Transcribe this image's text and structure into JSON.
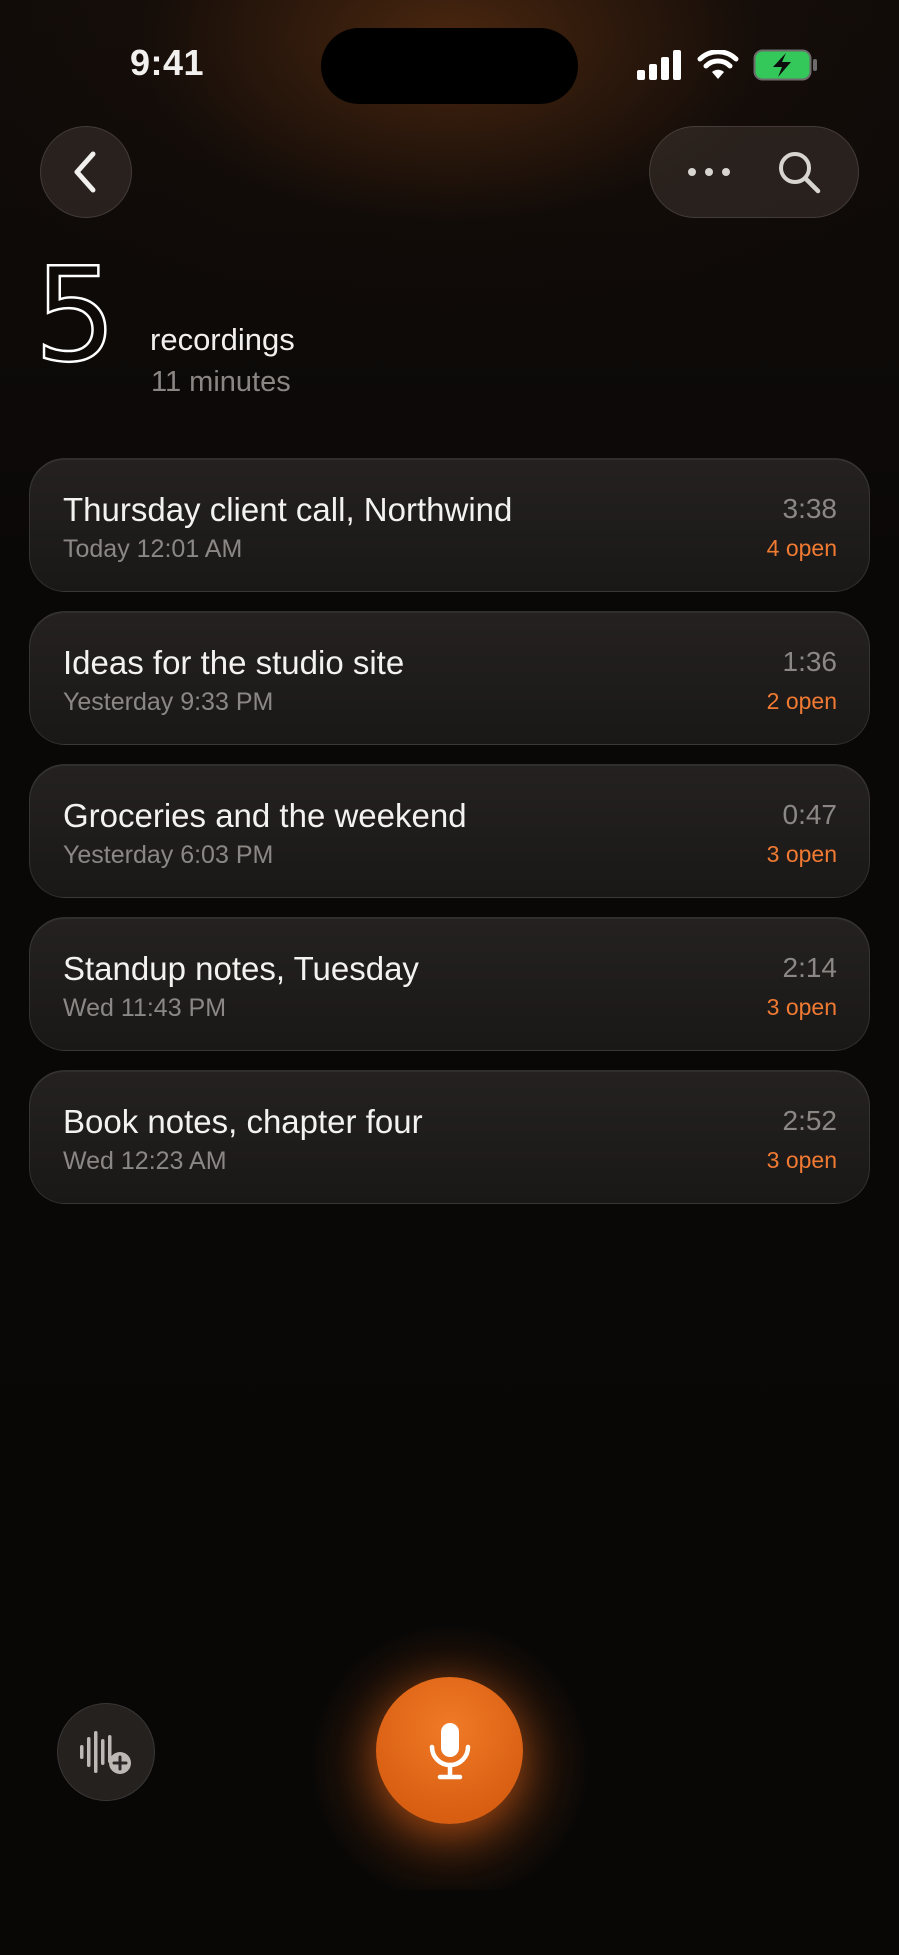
{
  "status_bar": {
    "time": "9:41",
    "icons": [
      "signal-icon",
      "wifi-icon",
      "battery-charging-icon"
    ],
    "battery_color": "#34c759"
  },
  "nav": {
    "back_icon": "chevron-left-icon",
    "more_icon": "ellipsis-icon",
    "search_icon": "search-icon"
  },
  "summary": {
    "count": "5",
    "label": "recordings",
    "duration": "11 minutes"
  },
  "recordings": [
    {
      "title": "Thursday client call, Northwind",
      "date": "Today 12:01 AM",
      "duration": "3:38",
      "open": "4 open"
    },
    {
      "title": "Ideas for the studio site",
      "date": "Yesterday 9:33 PM",
      "duration": "1:36",
      "open": "2 open"
    },
    {
      "title": "Groceries and the weekend",
      "date": "Yesterday 6:03 PM",
      "duration": "0:47",
      "open": "3 open"
    },
    {
      "title": "Standup notes, Tuesday",
      "date": "Wed 11:43 PM",
      "duration": "2:14",
      "open": "3 open"
    },
    {
      "title": "Book notes, chapter four",
      "date": "Wed 12:23 AM",
      "duration": "2:52",
      "open": "3 open"
    }
  ],
  "bottom": {
    "add_audio_icon": "waveform-add-icon",
    "record_icon": "microphone-icon"
  },
  "colors": {
    "accent": "#e8681a",
    "open_text": "#f07a32"
  }
}
